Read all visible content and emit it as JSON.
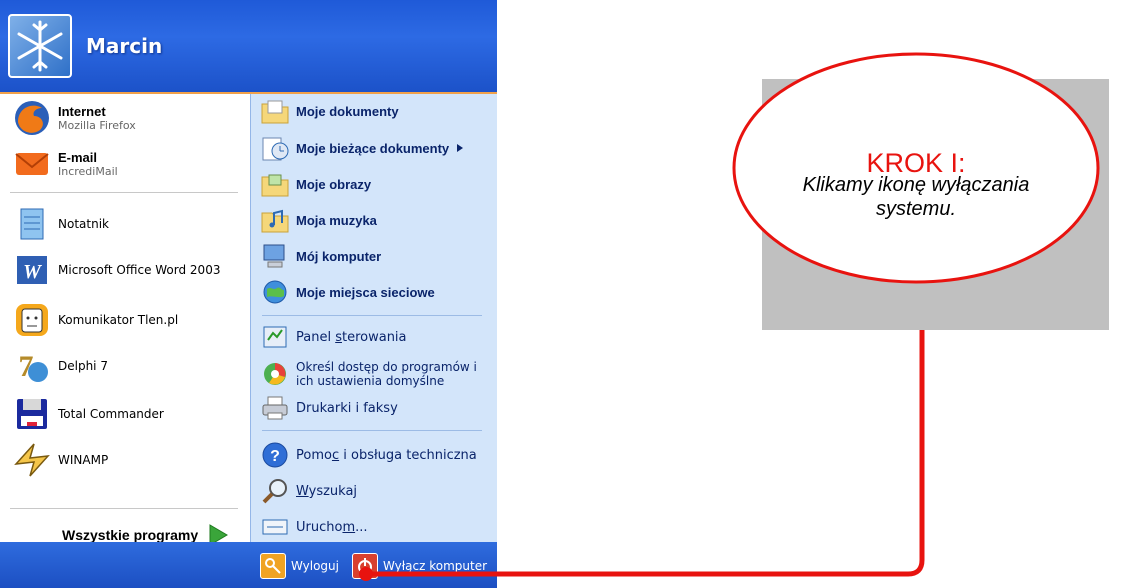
{
  "user": {
    "name": "Marcin"
  },
  "pinned": [
    {
      "title": "Internet",
      "subtitle": "Mozilla Firefox",
      "icon": "firefox-icon"
    },
    {
      "title": "E-mail",
      "subtitle": "IncrediMail",
      "icon": "incredimail-icon"
    }
  ],
  "recent": [
    {
      "label": "Notatnik",
      "icon": "notepad-icon"
    },
    {
      "label": "Microsoft Office Word 2003",
      "icon": "word-icon"
    },
    {
      "label": "Komunikator Tlen.pl",
      "icon": "tlen-icon"
    },
    {
      "label": "Delphi 7",
      "icon": "delphi-icon"
    },
    {
      "label": "Total Commander",
      "icon": "totalcommander-icon"
    },
    {
      "label": "WINAMP",
      "icon": "winamp-icon"
    }
  ],
  "all_programs": {
    "label": "Wszystkie programy"
  },
  "places": [
    {
      "label": "Moje dokumenty",
      "icon": "folder-documents-icon"
    },
    {
      "label": "Moje bieżące dokumenty",
      "icon": "recent-documents-icon"
    },
    {
      "label": "Moje obrazy",
      "icon": "folder-pictures-icon"
    },
    {
      "label": "Moja muzyka",
      "icon": "folder-music-icon"
    },
    {
      "label": "Mój komputer",
      "icon": "my-computer-icon"
    },
    {
      "label": "Moje miejsca sieciowe",
      "icon": "network-places-icon"
    }
  ],
  "system": [
    {
      "label": "Panel sterowania",
      "icon": "control-panel-icon"
    },
    {
      "label_line1": "Określ dostęp do programów i",
      "label_line2": "ich ustawienia domyślne",
      "icon": "program-access-icon"
    },
    {
      "label": "Drukarki i faksy",
      "icon": "printer-icon"
    }
  ],
  "help": [
    {
      "label": "Pomoc i obsługa techniczna",
      "icon": "help-icon"
    },
    {
      "label": "Wyszukaj",
      "icon": "search-icon"
    },
    {
      "label": "Uruchom...",
      "icon": "run-icon"
    }
  ],
  "footer": {
    "logoff": {
      "label": "Wyloguj",
      "icon": "logoff-key-icon"
    },
    "shutdown": {
      "label": "Wyłącz komputer",
      "icon": "shutdown-icon"
    }
  },
  "callout": {
    "title": "KROK I:",
    "line1": "Klikamy ikonę wyłączania",
    "line2": "systemu."
  },
  "colors": {
    "header_blue": "#2d6ae4",
    "right_panel": "#d3e5fa",
    "accent_red": "#e8130f",
    "callout_gray": "#c0c0c0"
  }
}
